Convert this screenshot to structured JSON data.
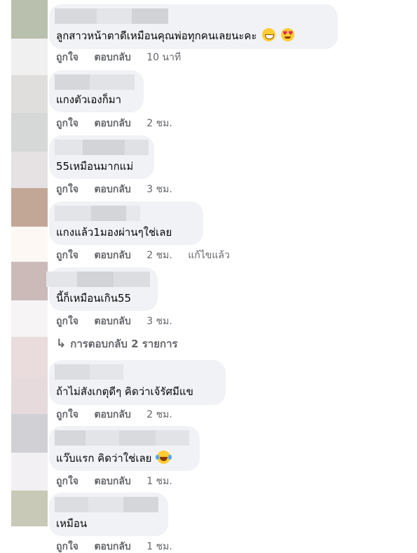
{
  "comments": [
    {
      "text": "ลูกสาวหน้าตาดีเหมือนคุณพ่อทุกคนเลยนะคะ",
      "emojis": [
        "grin-emoji",
        "heart-eyes-emoji"
      ],
      "like": "ถูกใจ",
      "reply": "ตอบกลับ",
      "time": "10 นาที",
      "edited": ""
    },
    {
      "text": "แกงตัวเองก็มา",
      "emojis": [],
      "like": "ถูกใจ",
      "reply": "ตอบกลับ",
      "time": "2 ชม.",
      "edited": ""
    },
    {
      "text": "55เหมือนมากแม่",
      "emojis": [],
      "like": "ถูกใจ",
      "reply": "ตอบกลับ",
      "time": "3 ชม.",
      "edited": ""
    },
    {
      "text": "แกงแล้ว1มองผ่านๆใช่เลย",
      "emojis": [],
      "like": "ถูกใจ",
      "reply": "ตอบกลับ",
      "time": "2 ชม.",
      "edited": "แก้ไขแล้ว"
    },
    {
      "text": "นี้ก็เหมือนเกิน55",
      "emojis": [],
      "like": "ถูกใจ",
      "reply": "ตอบกลับ",
      "time": "3 ชม.",
      "edited": ""
    },
    {
      "text": "ถ้าไม่สังเกตุดีๆ คิดว่าเจ้รัศมีแข",
      "emojis": [],
      "like": "ถูกใจ",
      "reply": "ตอบกลับ",
      "time": "2 ชม.",
      "edited": ""
    },
    {
      "text": "แว๊บแรก คิดว่าใช่เลย",
      "emojis": [
        "laughing-tears-emoji"
      ],
      "like": "ถูกใจ",
      "reply": "ตอบกลับ",
      "time": "1 ชม.",
      "edited": ""
    },
    {
      "text": "เหมือน",
      "emojis": [],
      "like": "ถูกใจ",
      "reply": "ตอบกลับ",
      "time": "1 ชม.",
      "edited": ""
    }
  ],
  "replies_link": "การตอบกลับ 2 รายการ",
  "colors": {
    "bubble": "#f0f2f5",
    "meta": "#65676b",
    "text": "#050505",
    "avatar_strip": [
      "#b9c0ad",
      "#f1f0f1",
      "#e0dedd",
      "#d6d7d7",
      "#e6e2e3",
      "#c3a796",
      "#fdf8f4",
      "#cbbab8",
      "#f6f4f5",
      "#eadcdc",
      "#e6dadc",
      "#d0d0d5",
      "#f2f0f2",
      "#c8c9b6"
    ]
  }
}
